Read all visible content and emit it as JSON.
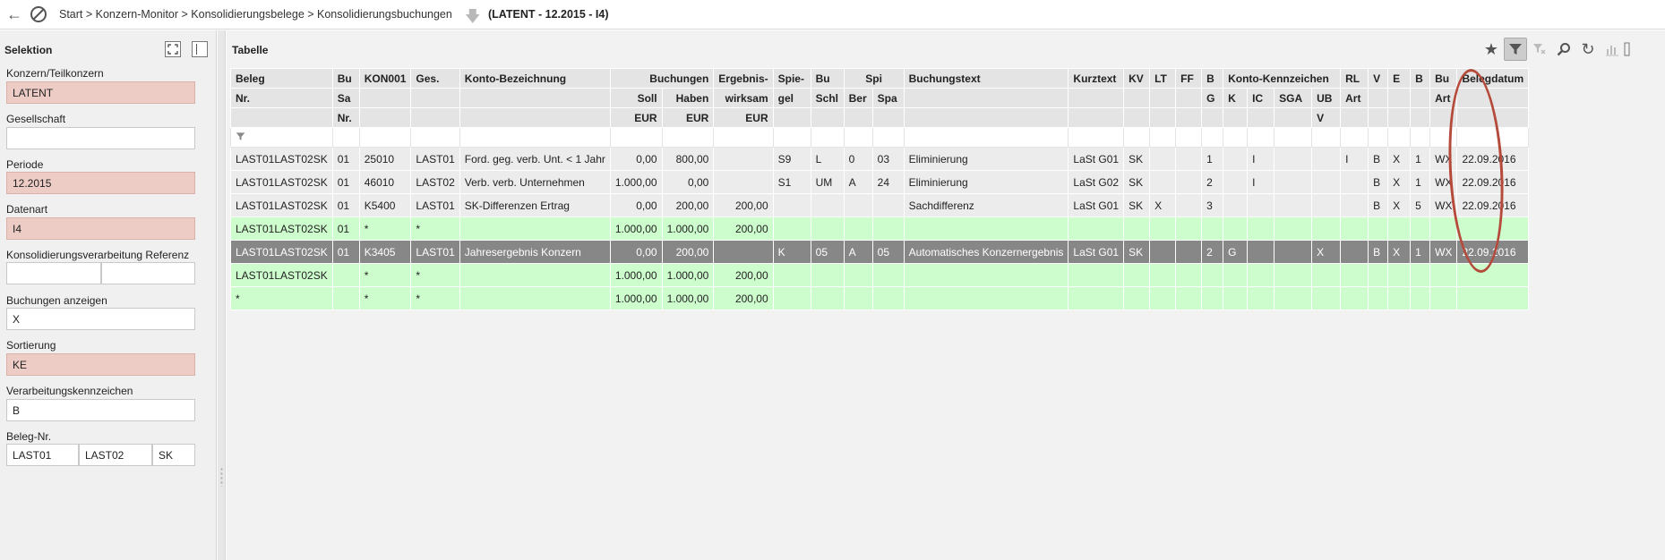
{
  "topbar": {
    "breadcrumb": "Start > Konzern-Monitor > Konsolidierungsbelege > Konsolidierungsbuchungen",
    "context": "(LATENT - 12.2015 - I4)"
  },
  "selection": {
    "title": "Selektion",
    "fields": [
      {
        "label": "Konzern/Teilkonzern",
        "value": "LATENT"
      },
      {
        "label": "Gesellschaft",
        "value": ""
      },
      {
        "label": "Periode",
        "value": "12.2015"
      },
      {
        "label": "Datenart",
        "value": "I4"
      },
      {
        "label": "Konsolidierungsverarbeitung Referenz",
        "value1": "",
        "value2": ""
      },
      {
        "label": "Buchungen anzeigen",
        "value": "X"
      },
      {
        "label": "Sortierung",
        "value": "KE"
      },
      {
        "label": "Verarbeitungskennzeichen",
        "value": "B"
      },
      {
        "label": "Beleg-Nr.",
        "value1": "LAST01",
        "value2": "LAST02",
        "value3": "SK"
      }
    ]
  },
  "table": {
    "title": "Tabelle",
    "header": {
      "beleg": "Beleg",
      "beleg_nr": "Nr.",
      "bu": "Bu",
      "bu_sa": "Sa",
      "bu_nr": "Nr.",
      "kon": "KON001",
      "ges": "Ges.",
      "konto_bez": "Konto-Bezeichnung",
      "buchungen": "Buchungen",
      "soll": "Soll",
      "haben": "Haben",
      "eur": "EUR",
      "erg1": "Ergebnis-",
      "erg2": "wirksam",
      "erg_eur": "EUR",
      "spie1": "Spie-",
      "spie2": "gel",
      "bu_schl1": "Bu",
      "bu_schl2": "Schl",
      "spi": "Spi",
      "ber": "Ber",
      "spa": "Spa",
      "buchungstext": "Buchungstext",
      "kurztext": "Kurztext",
      "kv": "KV",
      "lt": "LT",
      "ff": "FF",
      "bg1": "B",
      "bg2": "G",
      "kk": "Konto-Kennzeichen",
      "k": "K",
      "ic": "IC",
      "sga": "SGA",
      "ubv1": "UB",
      "ubv2": "V",
      "rl1": "RL",
      "rl2": "Art",
      "v": "V",
      "e": "E",
      "b": "B",
      "buart1": "Bu",
      "buart2": "Art",
      "belegdatum": "Belegdatum"
    },
    "rows": [
      {
        "style": "normal",
        "cells": [
          "LAST01LAST02SK",
          "01",
          "25010",
          "LAST01",
          "Ford. geg. verb. Unt. < 1 Jahr",
          "0,00",
          "800,00",
          "",
          "S9",
          "L",
          "0",
          "03",
          "Eliminierung",
          "LaSt G01",
          "SK",
          "",
          "",
          "1",
          "",
          "I",
          "",
          "",
          "I",
          "B",
          "X",
          "1",
          "WX",
          "22.09.2016"
        ]
      },
      {
        "style": "normal",
        "cells": [
          "LAST01LAST02SK",
          "01",
          "46010",
          "LAST02",
          "Verb. verb. Unternehmen",
          "1.000,00",
          "0,00",
          "",
          "S1",
          "UM",
          "A",
          "24",
          "Eliminierung",
          "LaSt G02",
          "SK",
          "",
          "",
          "2",
          "",
          "I",
          "",
          "",
          "",
          "B",
          "X",
          "1",
          "WX",
          "22.09.2016"
        ]
      },
      {
        "style": "normal",
        "cells": [
          "LAST01LAST02SK",
          "01",
          "K5400",
          "LAST01",
          "SK-Differenzen Ertrag",
          "0,00",
          "200,00",
          "200,00",
          "",
          "",
          "",
          "",
          "Sachdifferenz",
          "LaSt G01",
          "SK",
          "X",
          "",
          "3",
          "",
          "",
          "",
          "",
          "",
          "B",
          "X",
          "5",
          "WX",
          "22.09.2016"
        ]
      },
      {
        "style": "green",
        "cells": [
          "LAST01LAST02SK",
          "01",
          "*",
          "*",
          "",
          "1.000,00",
          "1.000,00",
          "200,00",
          "",
          "",
          "",
          "",
          "",
          "",
          "",
          "",
          "",
          "",
          "",
          "",
          "",
          "",
          "",
          "",
          "",
          "",
          "",
          ""
        ]
      },
      {
        "style": "hl",
        "cells": [
          "LAST01LAST02SK",
          "01",
          "K3405",
          "LAST01",
          "Jahresergebnis Konzern",
          "0,00",
          "200,00",
          "",
          "K",
          "05",
          "A",
          "05",
          "Automatisches Konzernergebnis",
          "LaSt G01",
          "SK",
          "",
          "",
          "2",
          "G",
          "",
          "",
          "X",
          "",
          "B",
          "X",
          "1",
          "WX",
          "22.09.2016"
        ]
      },
      {
        "style": "green",
        "cells": [
          "LAST01LAST02SK",
          "",
          "*",
          "*",
          "",
          "1.000,00",
          "1.000,00",
          "200,00",
          "",
          "",
          "",
          "",
          "",
          "",
          "",
          "",
          "",
          "",
          "",
          "",
          "",
          "",
          "",
          "",
          "",
          "",
          "",
          ""
        ]
      },
      {
        "style": "green",
        "cells": [
          "*",
          "",
          "*",
          "*",
          "",
          "1.000,00",
          "1.000,00",
          "200,00",
          "",
          "",
          "",
          "",
          "",
          "",
          "",
          "",
          "",
          "",
          "",
          "",
          "",
          "",
          "",
          "",
          "",
          "",
          "",
          ""
        ]
      }
    ]
  },
  "colors": {
    "required_field": "#edccc5",
    "subtotal_row": "#cdfccd",
    "selected_row": "#878787",
    "annotation": "#b5493a"
  }
}
